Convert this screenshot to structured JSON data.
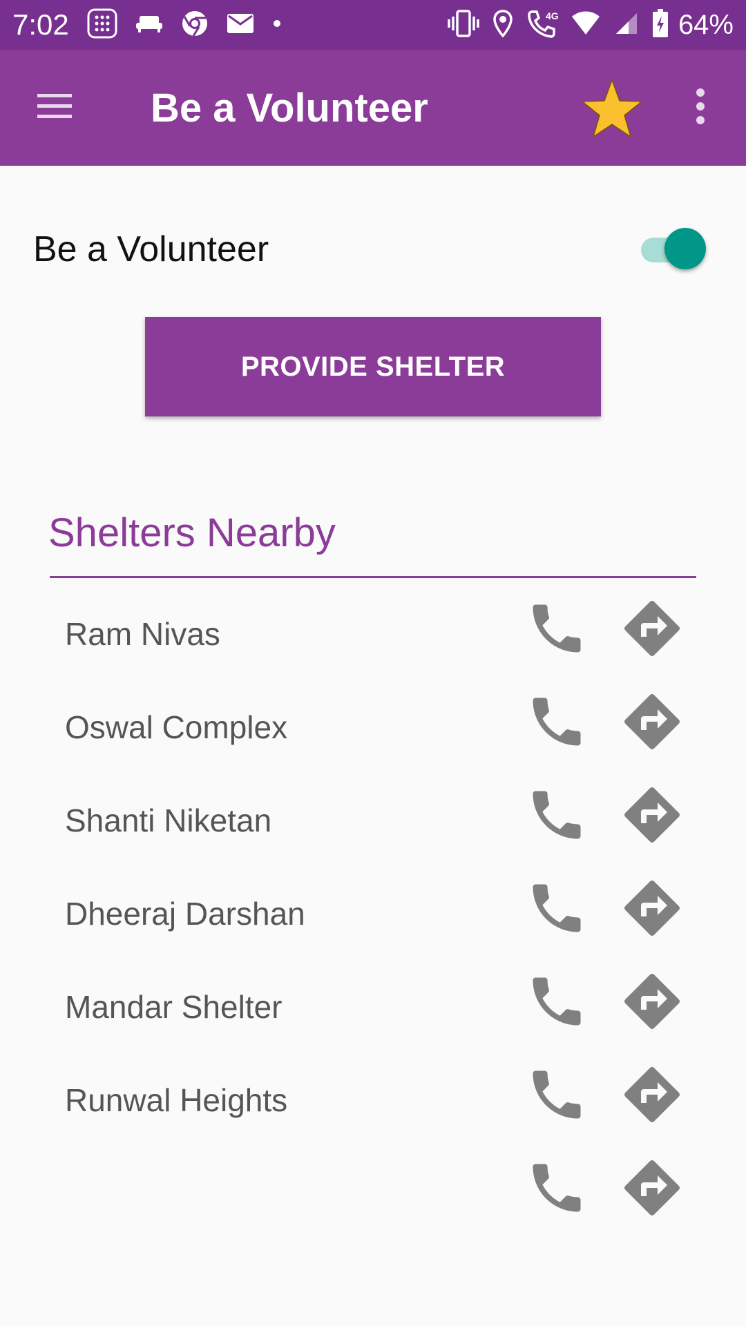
{
  "status_bar": {
    "time": "7:02",
    "network": "4G",
    "battery": "64%",
    "left_icons": [
      "dialpad-icon",
      "sofa-icon",
      "chrome-icon",
      "mail-icon",
      "dot-icon"
    ],
    "right_icons": [
      "vibrate-icon",
      "location-icon",
      "call-icon",
      "wifi-icon",
      "signal-icon",
      "battery-icon"
    ]
  },
  "app_bar": {
    "title": "Be a Volunteer",
    "icons": [
      "menu-icon",
      "star-icon",
      "more-vert-icon"
    ],
    "star_color": "#fbc02d"
  },
  "volunteer": {
    "label": "Be a Volunteer",
    "toggle_on": true
  },
  "provide_button": {
    "label": "PROVIDE SHELTER"
  },
  "shelters": {
    "heading": "Shelters Nearby",
    "items": [
      {
        "name": "Ram Nivas"
      },
      {
        "name": "Oswal Complex"
      },
      {
        "name": "Shanti Niketan"
      },
      {
        "name": "Dheeraj Darshan"
      },
      {
        "name": "Mandar Shelter"
      },
      {
        "name": "Runwal Heights"
      },
      {
        "name": ""
      }
    ],
    "row_icons": [
      "phone-icon",
      "directions-icon"
    ]
  },
  "colors": {
    "status_bar": "#77308f",
    "primary": "#8b3b98",
    "accent": "#009688",
    "icon_gray": "#808080"
  }
}
